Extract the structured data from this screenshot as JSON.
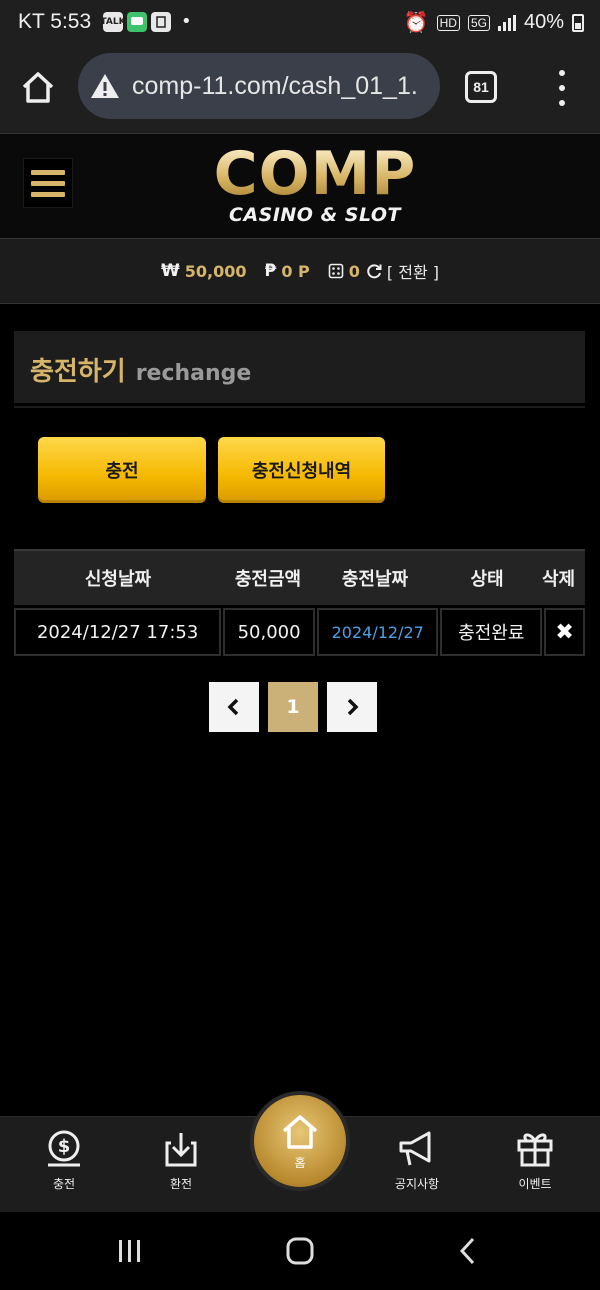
{
  "status_bar": {
    "carrier_time": "KT 5:53",
    "left_icons": [
      "TALK",
      "SMS",
      "NEWS"
    ],
    "right_icons": [
      "alarm-icon",
      "hd-icon",
      "5g-icon",
      "signal-icon"
    ],
    "battery": "40%"
  },
  "browser": {
    "url": "comp-11.com/cash_01_1.",
    "tab_count": "81"
  },
  "site": {
    "logo_main": "COMP",
    "logo_sub": "CASINO & SLOT"
  },
  "balance": {
    "money": "50,000",
    "money_symbol": "₩",
    "point": "0 P",
    "point_symbol": "₱",
    "chip": "0",
    "convert_label": "[ 전환 ]"
  },
  "page_title": {
    "ko": "충전하기",
    "en": "rechange"
  },
  "actions": {
    "charge": "충전",
    "history": "충전신청내역"
  },
  "table": {
    "headers": [
      "신청날짜",
      "충전금액",
      "충전날짜",
      "상태",
      "삭제"
    ],
    "rows": [
      {
        "request_date": "2024/12/27 17:53",
        "amount": "50,000",
        "charge_date": "2024/12/27",
        "status": "충전완료",
        "delete": "✖"
      }
    ]
  },
  "pagination": {
    "current": "1"
  },
  "bottom_nav": {
    "charge": "충전",
    "withdraw": "환전",
    "home": "홈",
    "notice": "공지사항",
    "event": "이벤트"
  },
  "colors": {
    "gold": "#d6b46a",
    "button_gold": "#f5b800",
    "link_blue": "#4ea0e6"
  }
}
